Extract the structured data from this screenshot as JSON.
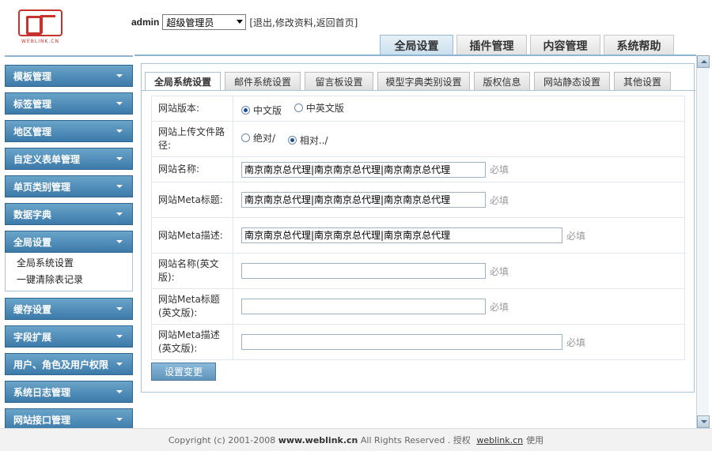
{
  "header": {
    "logo_text": "WEBLINK.CN",
    "user_name": "admin",
    "role_selected": "超级管理员",
    "links": "[退出,修改资料,返回首页]"
  },
  "top_tabs": [
    {
      "label": "全局设置",
      "active": true
    },
    {
      "label": "插件管理",
      "active": false
    },
    {
      "label": "内容管理",
      "active": false
    },
    {
      "label": "系统帮助",
      "active": false
    }
  ],
  "sidebar": {
    "items": [
      {
        "label": "模板管理"
      },
      {
        "label": "标签管理"
      },
      {
        "label": "地区管理"
      },
      {
        "label": "自定义表单管理"
      },
      {
        "label": "单页类别管理"
      },
      {
        "label": "数据字典"
      },
      {
        "label": "全局设置",
        "sub": [
          "全局系统设置",
          "一键清除表记录"
        ]
      },
      {
        "label": "缓存设置"
      },
      {
        "label": "字段扩展"
      },
      {
        "label": "用户、角色及用户权限"
      },
      {
        "label": "系统日志管理"
      },
      {
        "label": "网站接口管理"
      }
    ]
  },
  "sub_tabs": [
    {
      "label": "全局系统设置",
      "active": true
    },
    {
      "label": "邮件系统设置",
      "active": false
    },
    {
      "label": "留言板设置",
      "active": false
    },
    {
      "label": "模型字典类别设置",
      "active": false
    },
    {
      "label": "版权信息",
      "active": false
    },
    {
      "label": "网站静态设置",
      "active": false
    },
    {
      "label": "其他设置",
      "active": false
    }
  ],
  "form": {
    "version_label": "网站版本:",
    "version_opt_cn": "中文版",
    "version_opt_cn_en": "中英文版",
    "upload_label": "网站上传文件路径:",
    "upload_opt_abs": "绝对/",
    "upload_opt_rel": "相对../",
    "name_label": "网站名称:",
    "name_value": "南京南京总代理|南京南京总代理|南京南京总代理",
    "meta_title_label": "网站Meta标题:",
    "meta_title_value": "南京南京总代理|南京南京总代理|南京南京总代理",
    "meta_desc_label": "网站Meta描述:",
    "meta_desc_value": "南京南京总代理|南京南京总代理|南京南京总代理",
    "name_en_label": "网站名称(英文版):",
    "name_en_value": "",
    "meta_title_en_label": "网站Meta标题(英文版):",
    "meta_title_en_value": "",
    "meta_desc_en_label": "网站Meta描述(英文版):",
    "meta_desc_en_value": "",
    "required": "必填",
    "save_label": "设置变更"
  },
  "footer": {
    "prefix": "Copyright (c) 2001-2008 ",
    "site": "www.weblink.cn",
    "middle": " All Rights Reserved . 授权 ",
    "link": "weblink.cn",
    "suffix": "使用"
  }
}
